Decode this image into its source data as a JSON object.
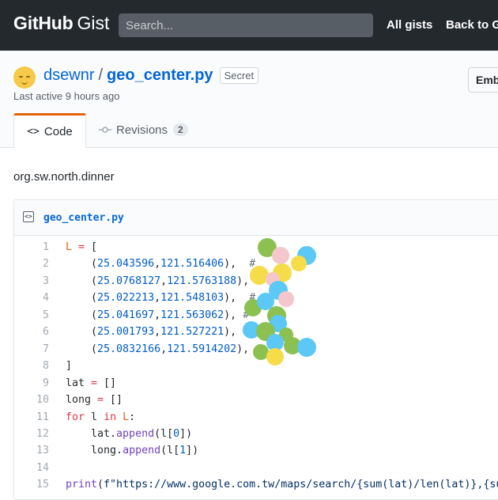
{
  "header": {
    "logo_brand": "GitHub",
    "logo_product": "Gist",
    "search_placeholder": "Search...",
    "nav_all_gists": "All gists",
    "nav_back": "Back to G"
  },
  "gist": {
    "owner": "dsewnr",
    "separator": "/",
    "filename": "geo_center.py",
    "visibility": "Secret",
    "last_active": "Last active 9 hours ago",
    "tabs": [
      {
        "label": "Code",
        "icon": "code-icon"
      },
      {
        "label": "Revisions",
        "icon": "git-commit-icon",
        "count": "2"
      }
    ],
    "embed_label": "Emb",
    "description": "org.sw.north.dinner"
  },
  "file": {
    "name": "geo_center.py",
    "line_numbers": [
      "1",
      "2",
      "3",
      "4",
      "5",
      "6",
      "7",
      "8",
      "9",
      "10",
      "11",
      "12",
      "13",
      "14",
      "15"
    ],
    "lines": [
      "L = [",
      "    (25.043596,121.516406),  # ",
      "    (25.0768127,121.5763188), #",
      "    (25.022213,121.548103),  # ",
      "    (25.041697,121.563062), # ",
      "    (25.001793,121.527221), # ",
      "    (25.0832166,121.5914202), #",
      "]",
      "lat = []",
      "long = []",
      "for l in L:",
      "    lat.append(l[0])",
      "    long.append(l[1])",
      "",
      "print(f\"https://www.google.com.tw/maps/search/{sum(lat)/len(lat)},{sum("
    ]
  },
  "colors": {
    "header_bg": "#24292e",
    "link_blue": "#0366d6",
    "tab_accent": "#e36209"
  }
}
